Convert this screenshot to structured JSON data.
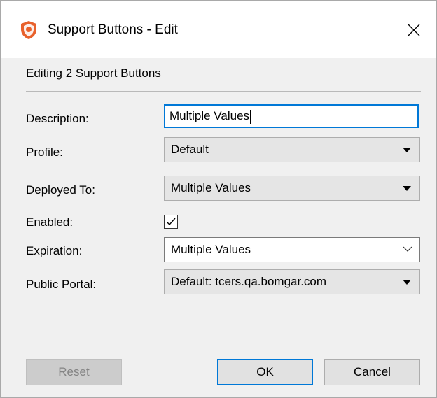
{
  "window": {
    "title": "Support Buttons - Edit",
    "app_icon": "bomgar-shield-icon",
    "close_icon": "close-icon"
  },
  "form": {
    "header": "Editing 2 Support Buttons",
    "fields": {
      "description": {
        "label": "Description:",
        "value": "Multiple Values"
      },
      "profile": {
        "label": "Profile:",
        "value": "Default"
      },
      "deployed_to": {
        "label": "Deployed To:",
        "value": "Multiple Values"
      },
      "enabled": {
        "label": "Enabled:",
        "checked": true
      },
      "expiration": {
        "label": "Expiration:",
        "value": "Multiple Values"
      },
      "public_portal": {
        "label": "Public Portal:",
        "value": "Default: tcers.qa.bomgar.com"
      }
    }
  },
  "buttons": {
    "reset": "Reset",
    "ok": "OK",
    "cancel": "Cancel"
  },
  "colors": {
    "accent": "#0078d7",
    "icon_orange": "#e8612c",
    "dialog_bg": "#f0f0f0"
  }
}
